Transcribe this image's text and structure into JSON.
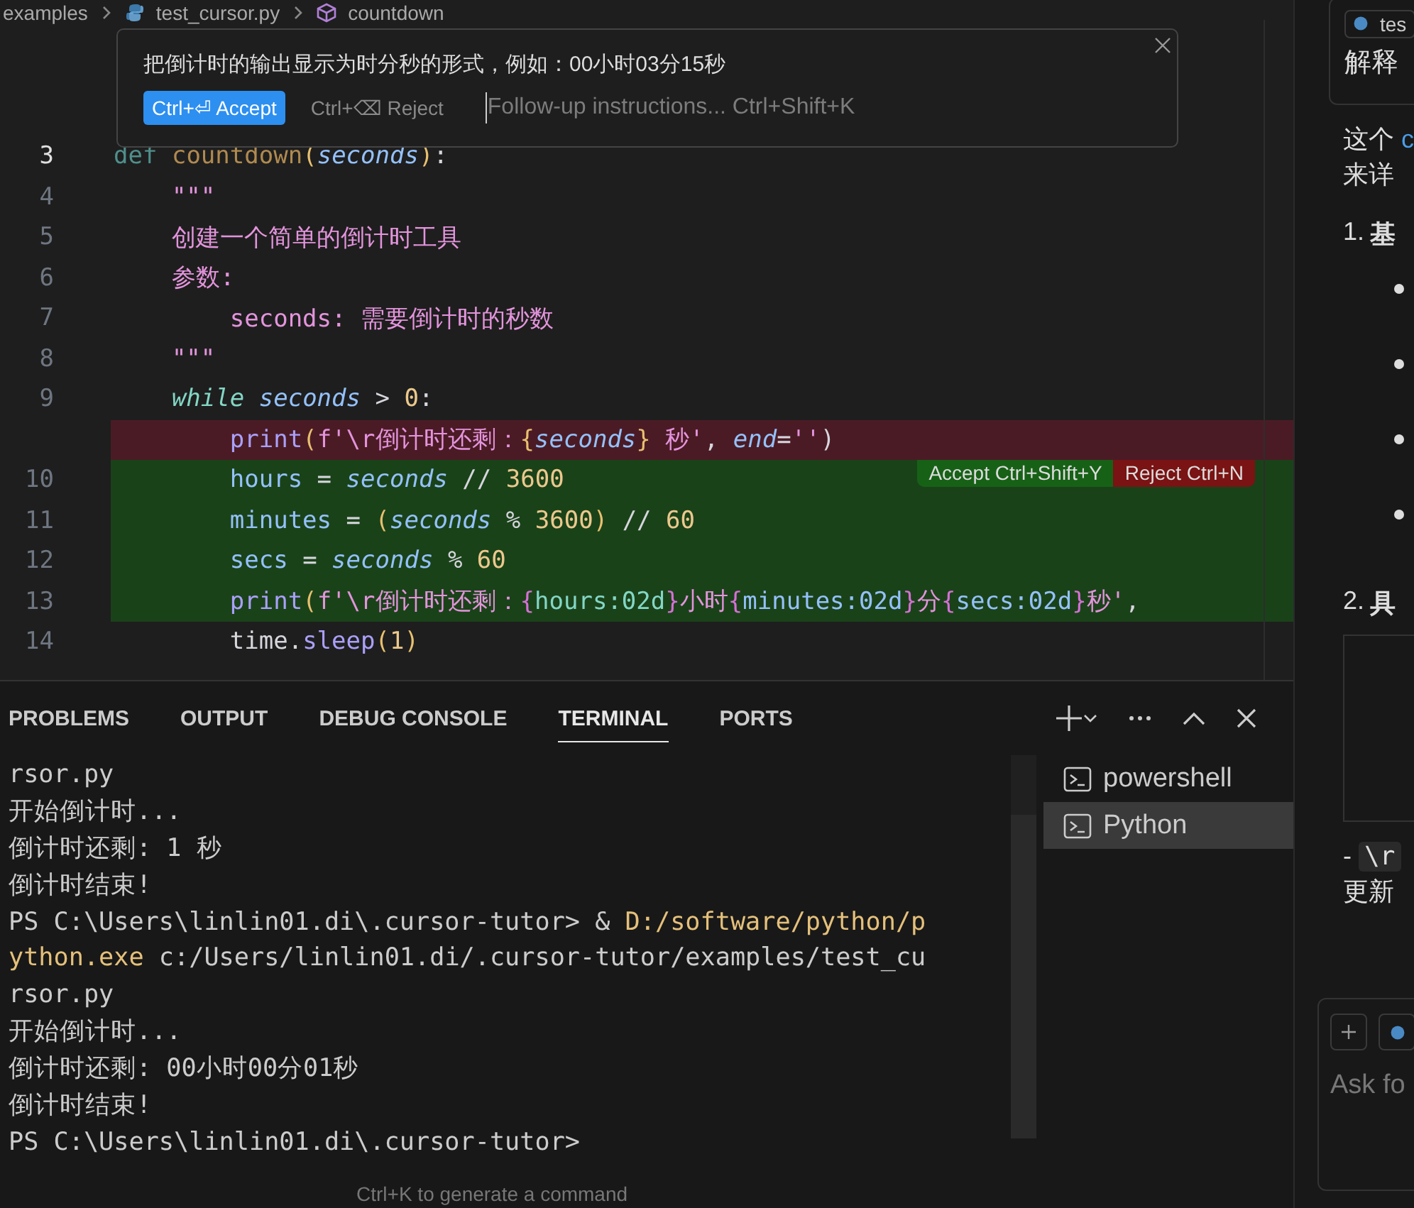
{
  "breadcrumb": [
    "examples",
    "test_cursor.py",
    "countdown"
  ],
  "prompt_box": {
    "text": "把倒计时的输出显示为时分秒的形式，例如：00小时03分15秒",
    "accept": "Ctrl+⏎ Accept",
    "reject": "Ctrl+⌫ Reject",
    "placeholder": "Follow-up instructions... Ctrl+Shift+K"
  },
  "code_lines": [
    {
      "number": "3",
      "current": true,
      "kind": "plain",
      "tokens": [
        {
          "t": "def",
          "kind": "kw"
        },
        {
          "t": " countdown",
          "kind": "fn-dim"
        },
        {
          "t": "(",
          "kind": "brace"
        },
        {
          "t": "seconds",
          "kind": "param"
        },
        {
          "t": ")",
          "kind": "brace"
        },
        {
          "t": ":",
          "kind": "plain"
        }
      ]
    },
    {
      "number": "4",
      "current": false,
      "kind": "plain",
      "tokens": [
        {
          "t": "    \"\"\"",
          "kind": "str"
        }
      ]
    },
    {
      "number": "5",
      "current": false,
      "kind": "plain",
      "tokens": [
        {
          "t": "    创建一个简单的倒计时工具",
          "kind": "str"
        }
      ]
    },
    {
      "number": "6",
      "current": false,
      "kind": "plain",
      "tokens": [
        {
          "t": "    参数:",
          "kind": "str"
        }
      ]
    },
    {
      "number": "7",
      "current": false,
      "kind": "plain",
      "tokens": [
        {
          "t": "        seconds: 需要倒计时的秒数",
          "kind": "str"
        }
      ]
    },
    {
      "number": "8",
      "current": false,
      "kind": "plain",
      "tokens": [
        {
          "t": "    \"\"\"",
          "kind": "str"
        }
      ]
    },
    {
      "number": "9",
      "current": false,
      "kind": "plain",
      "tokens": [
        {
          "t": "    while",
          "kind": "ctrl"
        },
        {
          "t": " seconds",
          "kind": "param"
        },
        {
          "t": " > ",
          "kind": "plain"
        },
        {
          "t": "0",
          "kind": "num"
        },
        {
          "t": ":",
          "kind": "plain"
        }
      ]
    },
    {
      "kind": "removed",
      "tokens": [
        {
          "t": "        print",
          "kind": "fn"
        },
        {
          "t": "(",
          "kind": "brace"
        },
        {
          "t": "f'\\r倒计时还剩：",
          "kind": "str"
        },
        {
          "t": "{",
          "kind": "brace"
        },
        {
          "t": "seconds",
          "kind": "param"
        },
        {
          "t": "}",
          "kind": "brace"
        },
        {
          "t": " 秒'",
          "kind": "str"
        },
        {
          "t": ", ",
          "kind": "plain"
        },
        {
          "t": "end",
          "kind": "param"
        },
        {
          "t": "=",
          "kind": "plain"
        },
        {
          "t": "''",
          "kind": "str"
        },
        {
          "t": ")",
          "kind": "plain"
        }
      ]
    },
    {
      "number": "10",
      "current": false,
      "kind": "added",
      "show_actions": true,
      "tokens": [
        {
          "t": "        hours",
          "kind": "var"
        },
        {
          "t": " = ",
          "kind": "plain"
        },
        {
          "t": "seconds",
          "kind": "param"
        },
        {
          "t": " // ",
          "kind": "plain"
        },
        {
          "t": "3600",
          "kind": "num"
        }
      ]
    },
    {
      "number": "11",
      "current": false,
      "kind": "added",
      "tokens": [
        {
          "t": "        minutes",
          "kind": "var"
        },
        {
          "t": " = ",
          "kind": "plain"
        },
        {
          "t": "(",
          "kind": "brace"
        },
        {
          "t": "seconds",
          "kind": "param"
        },
        {
          "t": " % ",
          "kind": "plain"
        },
        {
          "t": "3600",
          "kind": "num"
        },
        {
          "t": ")",
          "kind": "brace"
        },
        {
          "t": " // ",
          "kind": "plain"
        },
        {
          "t": "60",
          "kind": "num"
        }
      ]
    },
    {
      "number": "12",
      "current": false,
      "kind": "added",
      "tokens": [
        {
          "t": "        secs",
          "kind": "var"
        },
        {
          "t": " = ",
          "kind": "plain"
        },
        {
          "t": "seconds",
          "kind": "param"
        },
        {
          "t": " % ",
          "kind": "plain"
        },
        {
          "t": "60",
          "kind": "num"
        }
      ]
    },
    {
      "number": "13",
      "current": false,
      "kind": "added",
      "tokens": [
        {
          "t": "        print",
          "kind": "fn"
        },
        {
          "t": "(",
          "kind": "brace"
        },
        {
          "t": "f'\\r倒计时还剩：",
          "kind": "str"
        },
        {
          "t": "{",
          "kind": "brace2"
        },
        {
          "t": "hours:02d",
          "kind": "fmt"
        },
        {
          "t": "}",
          "kind": "brace2"
        },
        {
          "t": "小时",
          "kind": "str"
        },
        {
          "t": "{",
          "kind": "brace2"
        },
        {
          "t": "minutes:02d",
          "kind": "var"
        },
        {
          "t": "}",
          "kind": "brace2"
        },
        {
          "t": "分",
          "kind": "str"
        },
        {
          "t": "{",
          "kind": "brace2"
        },
        {
          "t": "secs:02d",
          "kind": "var"
        },
        {
          "t": "}",
          "kind": "brace2"
        },
        {
          "t": "秒'",
          "kind": "str"
        },
        {
          "t": ",",
          "kind": "plain"
        }
      ]
    },
    {
      "number": "14",
      "current": false,
      "kind": "plain",
      "tokens": [
        {
          "t": "        time.",
          "kind": "plain"
        },
        {
          "t": "sleep",
          "kind": "fn"
        },
        {
          "t": "(",
          "kind": "brace"
        },
        {
          "t": "1",
          "kind": "num"
        },
        {
          "t": ")",
          "kind": "brace"
        }
      ]
    }
  ],
  "diff_actions": {
    "accept": "Accept Ctrl+Shift+Y",
    "reject": "Reject Ctrl+N"
  },
  "panel_tabs": [
    {
      "label": "PROBLEMS",
      "selected": false
    },
    {
      "label": "OUTPUT",
      "selected": false
    },
    {
      "label": "DEBUG CONSOLE",
      "selected": false
    },
    {
      "label": "TERMINAL",
      "selected": true
    },
    {
      "label": "PORTS",
      "selected": false
    }
  ],
  "terminal_lines": [
    [
      {
        "t": "rsor.py",
        "kind": "plain"
      }
    ],
    [
      {
        "t": "开始倒计时...",
        "kind": "plain"
      }
    ],
    [
      {
        "t": "倒计时还剩: 1 秒",
        "kind": "plain"
      }
    ],
    [
      {
        "t": "倒计时结束!",
        "kind": "plain"
      }
    ],
    [
      {
        "t": "PS C:\\Users\\linlin01.di\\.cursor-tutor> & ",
        "kind": "plain"
      },
      {
        "t": "D:/software/python/p",
        "kind": "path"
      }
    ],
    [
      {
        "t": "ython.exe",
        "kind": "path"
      },
      {
        "t": " c:/Users/linlin01.di/.cursor-tutor/examples/test_cu",
        "kind": "plain"
      }
    ],
    [
      {
        "t": "rsor.py",
        "kind": "plain"
      }
    ],
    [
      {
        "t": "开始倒计时...",
        "kind": "plain"
      }
    ],
    [
      {
        "t": "倒计时还剩: 00小时00分01秒",
        "kind": "plain"
      }
    ],
    [
      {
        "t": "倒计时结束!",
        "kind": "plain"
      }
    ],
    [
      {
        "t": "PS C:\\Users\\linlin01.di\\.cursor-tutor>",
        "kind": "plain"
      }
    ]
  ],
  "terminal_hint": "Ctrl+K to generate a command",
  "terminals": [
    {
      "label": "powershell",
      "selected": false
    },
    {
      "label": "Python",
      "selected": true
    }
  ],
  "chat": {
    "chip": "tes",
    "question": "解释",
    "intro": [
      {
        "t": "这个 ",
        "kind": "plain"
      },
      {
        "t": "c",
        "kind": "code"
      }
    ],
    "intro_2": "来详",
    "section_1": {
      "number": "1.",
      "title": "基"
    },
    "section_2": {
      "number": "2.",
      "title": "具"
    },
    "note": [
      {
        "t": "- ",
        "kind": "plain"
      },
      {
        "t": "\\r",
        "kind": "code"
      }
    ],
    "note_2": "更新",
    "input_placeholder": "Ask fo"
  }
}
